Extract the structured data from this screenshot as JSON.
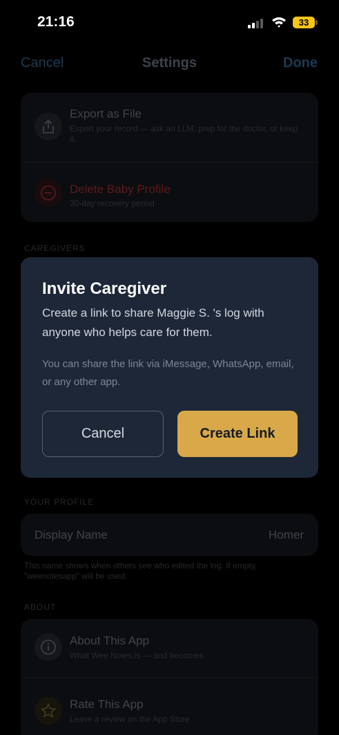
{
  "status_bar": {
    "time": "21:16",
    "battery": "33"
  },
  "nav": {
    "cancel": "Cancel",
    "title": "Settings",
    "done": "Done"
  },
  "data_card": {
    "export": {
      "title": "Export as File",
      "subtitle": "Export your record — ask an LLM, prep for the doctor, or keep it."
    },
    "delete": {
      "title": "Delete Baby Profile",
      "subtitle": "30-day recovery period"
    }
  },
  "sections": {
    "caregivers": "CAREGIVERS",
    "your_profile": "YOUR PROFILE",
    "about": "ABOUT"
  },
  "profile": {
    "display_name_label": "Display Name",
    "display_name_value": "Homer",
    "footnote": "This name shows when others see who edited the log. If empty, \"weenotesapp\" will be used."
  },
  "about_card": {
    "about": {
      "title": "About This App",
      "subtitle": "What Wee Notes is — and becomes"
    },
    "rate": {
      "title": "Rate This App",
      "subtitle": "Leave a review on the App Store"
    }
  },
  "modal": {
    "title": "Invite Caregiver",
    "body": "Create a link to share Maggie S. 's log with anyone who helps care for them.",
    "note": "You can share the link via iMessage, WhatsApp, email, or any other app.",
    "cancel": "Cancel",
    "create": "Create Link"
  },
  "colors": {
    "accent": "#d9a949",
    "modal_bg": "#1d2738",
    "destructive": "#7a1d1d"
  }
}
